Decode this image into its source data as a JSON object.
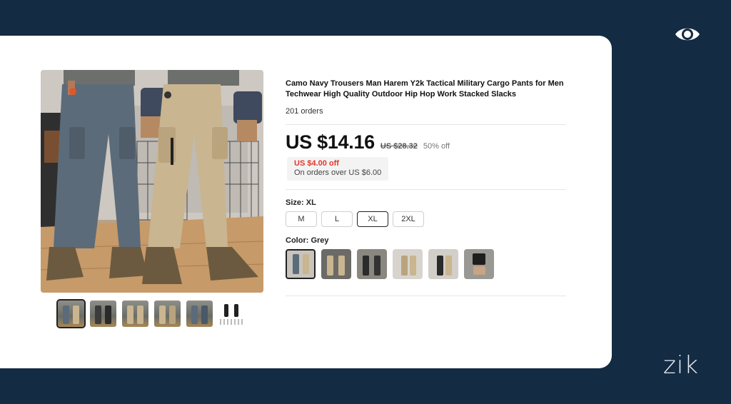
{
  "product": {
    "title": "Camo Navy Trousers Man Harem Y2k Tactical Military Cargo Pants for Men Techwear High Quality Outdoor Hip Hop Work Stacked Slacks",
    "orders": "201 orders",
    "price": "US $14.16",
    "old_price": "US $28.32",
    "discount": "50% off",
    "coupon": {
      "amount": "US $4.00 off",
      "condition": "On orders over US $6.00"
    }
  },
  "size": {
    "label": "Size: XL",
    "options": [
      "M",
      "L",
      "XL",
      "2XL"
    ],
    "selected": "XL"
  },
  "color": {
    "label": "Color: Grey",
    "selected_index": 0,
    "swatch_count": 6
  },
  "gallery": {
    "thumbnail_count": 6,
    "selected_index": 0
  },
  "brand": {
    "logo_text": "zik"
  },
  "icons": {
    "top_right": "eye-icon"
  },
  "colors": {
    "background": "#132b43",
    "card": "#ffffff",
    "coupon_red": "#e6352b",
    "selected_border": "#222222"
  }
}
